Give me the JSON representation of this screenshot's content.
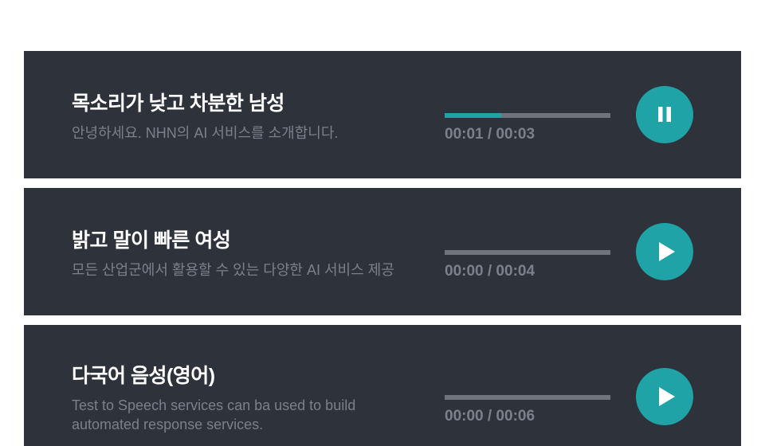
{
  "voices": [
    {
      "title": "목소리가 낮고 차분한 남성",
      "description": "안녕하세요. NHN의 AI 서비스를 소개합니다.",
      "time": "00:01 / 00:03",
      "progress": 0.34,
      "state": "playing",
      "control_icon": "pause-icon"
    },
    {
      "title": "밝고 말이 빠른 여성",
      "description": "모든 산업군에서 활용할 수 있는 다양한 AI 서비스 제공",
      "time": "00:00 / 00:04",
      "progress": 0,
      "state": "paused",
      "control_icon": "play-icon"
    },
    {
      "title": "다국어 음성(영어)",
      "description": "Test to Speech services can ba used to build automated response services.",
      "time": "00:00 / 00:06",
      "progress": 0,
      "state": "paused",
      "control_icon": "play-icon"
    }
  ],
  "colors": {
    "card_bg": "#2e323b",
    "accent": "#1fa3a7",
    "track": "#6f737c",
    "muted_text": "#7b808a",
    "title_text": "#ffffff"
  }
}
